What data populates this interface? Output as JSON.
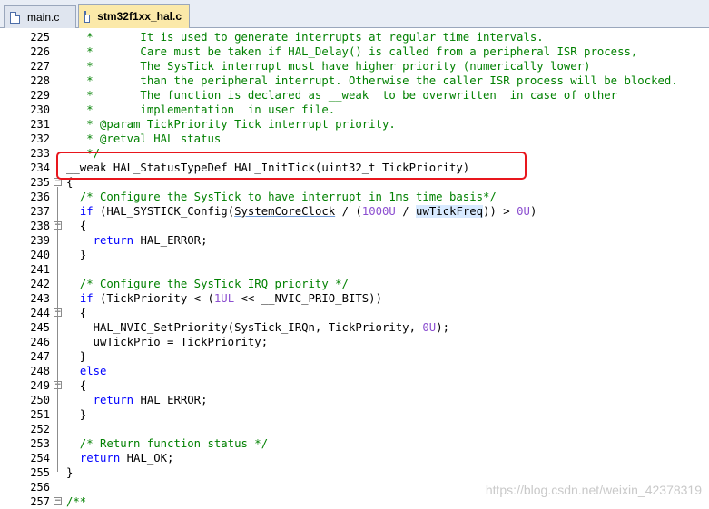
{
  "tabs": [
    {
      "label": "main.c",
      "active": false
    },
    {
      "label": "stm32f1xx_hal.c",
      "active": true
    }
  ],
  "lines": [
    {
      "num": "225",
      "fold": "",
      "parts": [
        {
          "t": "   *       It is used to generate interrupts at regular time intervals.",
          "c": "comment"
        }
      ]
    },
    {
      "num": "226",
      "fold": "",
      "parts": [
        {
          "t": "   *       Care must be taken if HAL_Delay() is called from a peripheral ISR process,",
          "c": "comment"
        }
      ]
    },
    {
      "num": "227",
      "fold": "",
      "parts": [
        {
          "t": "   *       The SysTick interrupt must have higher priority (numerically lower)",
          "c": "comment"
        }
      ]
    },
    {
      "num": "228",
      "fold": "",
      "parts": [
        {
          "t": "   *       than the peripheral interrupt. Otherwise the caller ISR process will be blocked.",
          "c": "comment"
        }
      ]
    },
    {
      "num": "229",
      "fold": "",
      "parts": [
        {
          "t": "   *       The function is declared as __weak  to be overwritten  in case of other",
          "c": "comment"
        }
      ]
    },
    {
      "num": "230",
      "fold": "",
      "parts": [
        {
          "t": "   *       implementation  in user file.",
          "c": "comment"
        }
      ]
    },
    {
      "num": "231",
      "fold": "",
      "parts": [
        {
          "t": "   * @param TickPriority Tick interrupt priority.",
          "c": "comment"
        }
      ]
    },
    {
      "num": "232",
      "fold": "",
      "parts": [
        {
          "t": "   * @retval HAL status",
          "c": "comment"
        }
      ]
    },
    {
      "num": "233",
      "fold": "",
      "parts": [
        {
          "t": "   */",
          "c": "comment"
        }
      ]
    },
    {
      "num": "234",
      "fold": "",
      "parts": [
        {
          "t": "__weak HAL_StatusTypeDef HAL_InitTick(uint32_t TickPriority)",
          "c": ""
        }
      ]
    },
    {
      "num": "235",
      "fold": "minus",
      "parts": [
        {
          "t": "{",
          "c": ""
        }
      ]
    },
    {
      "num": "236",
      "fold": "",
      "parts": [
        {
          "t": "  /* Configure the SysTick to have interrupt in 1ms time basis*/",
          "c": "comment"
        }
      ]
    },
    {
      "num": "237",
      "fold": "",
      "parts": [
        {
          "t": "  ",
          "c": ""
        },
        {
          "t": "if",
          "c": "kw"
        },
        {
          "t": " (HAL_SYSTICK_Config(",
          "c": ""
        },
        {
          "t": "SystemCoreClock",
          "c": "ul"
        },
        {
          "t": " / (",
          "c": ""
        },
        {
          "t": "1000U",
          "c": "num"
        },
        {
          "t": " / ",
          "c": ""
        },
        {
          "t": "uwTickFreq",
          "c": "hl"
        },
        {
          "t": ")) > ",
          "c": ""
        },
        {
          "t": "0U",
          "c": "num"
        },
        {
          "t": ")",
          "c": ""
        }
      ]
    },
    {
      "num": "238",
      "fold": "minus",
      "parts": [
        {
          "t": "  {",
          "c": ""
        }
      ]
    },
    {
      "num": "239",
      "fold": "",
      "parts": [
        {
          "t": "    ",
          "c": ""
        },
        {
          "t": "return",
          "c": "kw"
        },
        {
          "t": " HAL_ERROR;",
          "c": ""
        }
      ]
    },
    {
      "num": "240",
      "fold": "",
      "parts": [
        {
          "t": "  }",
          "c": ""
        }
      ]
    },
    {
      "num": "241",
      "fold": "",
      "parts": [
        {
          "t": "",
          "c": ""
        }
      ]
    },
    {
      "num": "242",
      "fold": "",
      "parts": [
        {
          "t": "  /* Configure the SysTick IRQ priority */",
          "c": "comment"
        }
      ]
    },
    {
      "num": "243",
      "fold": "",
      "parts": [
        {
          "t": "  ",
          "c": ""
        },
        {
          "t": "if",
          "c": "kw"
        },
        {
          "t": " (TickPriority < (",
          "c": ""
        },
        {
          "t": "1UL",
          "c": "num"
        },
        {
          "t": " << __NVIC_PRIO_BITS))",
          "c": ""
        }
      ]
    },
    {
      "num": "244",
      "fold": "minus",
      "parts": [
        {
          "t": "  {",
          "c": ""
        }
      ]
    },
    {
      "num": "245",
      "fold": "",
      "parts": [
        {
          "t": "    HAL_NVIC_SetPriority(SysTick_IRQn, TickPriority, ",
          "c": ""
        },
        {
          "t": "0U",
          "c": "num"
        },
        {
          "t": ");",
          "c": ""
        }
      ]
    },
    {
      "num": "246",
      "fold": "",
      "parts": [
        {
          "t": "    uwTickPrio = TickPriority;",
          "c": ""
        }
      ]
    },
    {
      "num": "247",
      "fold": "",
      "parts": [
        {
          "t": "  }",
          "c": ""
        }
      ]
    },
    {
      "num": "248",
      "fold": "",
      "parts": [
        {
          "t": "  ",
          "c": ""
        },
        {
          "t": "else",
          "c": "kw"
        }
      ]
    },
    {
      "num": "249",
      "fold": "minus",
      "parts": [
        {
          "t": "  {",
          "c": ""
        }
      ]
    },
    {
      "num": "250",
      "fold": "",
      "parts": [
        {
          "t": "    ",
          "c": ""
        },
        {
          "t": "return",
          "c": "kw"
        },
        {
          "t": " HAL_ERROR;",
          "c": ""
        }
      ]
    },
    {
      "num": "251",
      "fold": "",
      "parts": [
        {
          "t": "  }",
          "c": ""
        }
      ]
    },
    {
      "num": "252",
      "fold": "",
      "parts": [
        {
          "t": "",
          "c": ""
        }
      ]
    },
    {
      "num": "253",
      "fold": "",
      "parts": [
        {
          "t": "  /* Return function status */",
          "c": "comment"
        }
      ]
    },
    {
      "num": "254",
      "fold": "",
      "parts": [
        {
          "t": "  ",
          "c": ""
        },
        {
          "t": "return",
          "c": "kw"
        },
        {
          "t": " HAL_OK;",
          "c": ""
        }
      ]
    },
    {
      "num": "255",
      "fold": "",
      "parts": [
        {
          "t": "}",
          "c": ""
        }
      ]
    },
    {
      "num": "256",
      "fold": "",
      "parts": [
        {
          "t": "",
          "c": ""
        }
      ]
    },
    {
      "num": "257",
      "fold": "minus",
      "parts": [
        {
          "t": "/**",
          "c": "comment"
        }
      ]
    }
  ],
  "highlight": {
    "line": "234",
    "color": "#e8161d"
  },
  "watermark": "https://blog.csdn.net/weixin_42378319",
  "colors": {
    "comment": "#008000",
    "keyword": "#0000ff",
    "number": "#8c4fd0",
    "tab_active": "#fbe9a9"
  }
}
